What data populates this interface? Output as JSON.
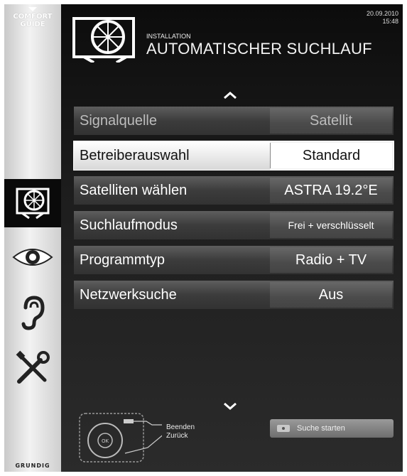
{
  "sidebar": {
    "comfort_guide": "COMFORT GUIDE",
    "brand": "GRUNDIG",
    "icons": [
      {
        "name": "satellite-dish-icon",
        "active": true
      },
      {
        "name": "eye-icon",
        "active": false
      },
      {
        "name": "ear-icon",
        "active": false
      },
      {
        "name": "tools-icon",
        "active": false
      }
    ]
  },
  "header": {
    "date": "20.09.2010",
    "time": "15:48",
    "subtitle": "INSTALLATION",
    "title": "AUTOMATISCHER SUCHLAUF"
  },
  "menu": [
    {
      "label": "Signalquelle",
      "value": "Satellit",
      "state": "disabled"
    },
    {
      "label": "Betreiberauswahl",
      "value": "Standard",
      "state": "selected"
    },
    {
      "label": "Satelliten wählen",
      "value": "ASTRA 19.2°E",
      "state": "normal"
    },
    {
      "label": "Suchlaufmodus",
      "value": "Frei + verschlüsselt",
      "state": "normal"
    },
    {
      "label": "Programmtyp",
      "value": "Radio + TV",
      "state": "normal"
    },
    {
      "label": "Netzwerksuche",
      "value": "Aus",
      "state": "normal"
    }
  ],
  "footer": {
    "exit_label": "Beenden",
    "back_label": "Zurück",
    "start_label": "Suche starten"
  },
  "colors": {
    "background": "#0d0d0d",
    "sidebar": "#e6e6e6",
    "selected": "#ffffff"
  }
}
